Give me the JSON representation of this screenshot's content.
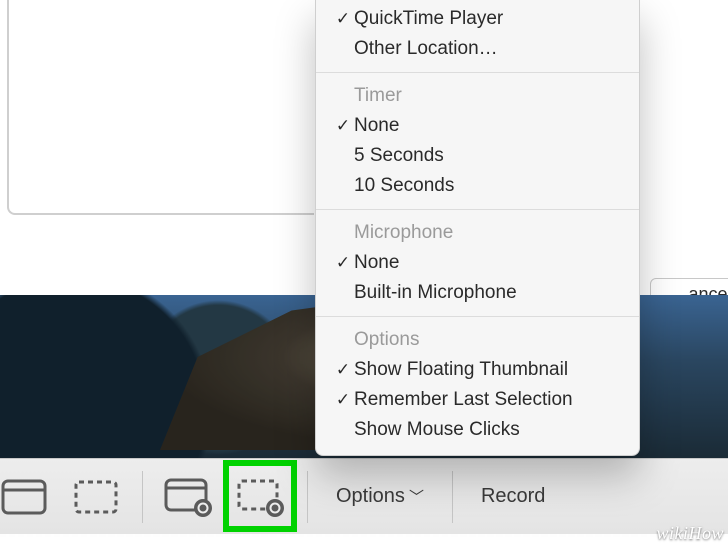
{
  "menu": {
    "saveTo": {
      "quicktime": "QuickTime Player",
      "other": "Other Location…"
    },
    "timer": {
      "header": "Timer",
      "none": "None",
      "five": "5 Seconds",
      "ten": "10 Seconds"
    },
    "microphone": {
      "header": "Microphone",
      "none": "None",
      "builtin": "Built-in Microphone"
    },
    "options": {
      "header": "Options",
      "thumbnail": "Show Floating Thumbnail",
      "remember": "Remember Last Selection",
      "clicks": "Show Mouse Clicks"
    },
    "checks": {
      "quicktime": true,
      "timer_none": true,
      "mic_none": true,
      "thumbnail": true,
      "remember": true
    }
  },
  "toolbar": {
    "options_label": "Options",
    "record_label": "Record"
  },
  "dialog": {
    "cancel_label": "ancel"
  },
  "watermark": "wikiHow"
}
